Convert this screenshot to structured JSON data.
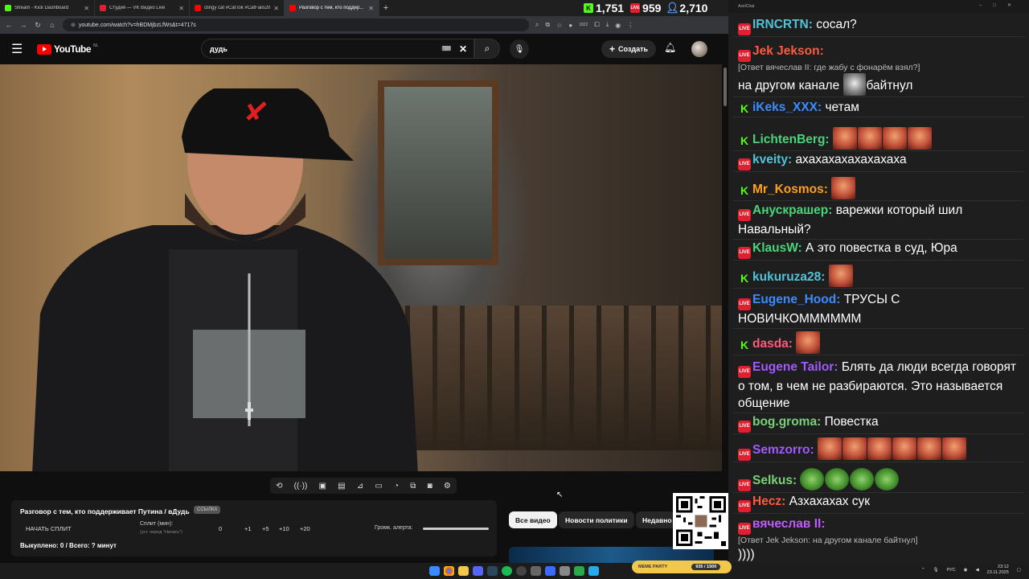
{
  "tabs": [
    {
      "title": "Stream - Kick Dashboard",
      "color": "#53fc18",
      "active": false
    },
    {
      "title": "Студия — VK Видео Live",
      "color": "#e0202f",
      "active": false
    },
    {
      "title": "clingy cat #CatTok #CatFails20...",
      "color": "#ff0000",
      "active": false
    },
    {
      "title": "Разговор с тем, кто поддер...",
      "color": "#ff0000",
      "active": true
    }
  ],
  "counters": [
    {
      "icon": "K",
      "value": "1,751",
      "color": "#53fc18"
    },
    {
      "icon": "LIVE",
      "value": "959",
      "color": "#e0202f"
    },
    {
      "icon": "person",
      "value": "2,710",
      "color": "#5aa0ff"
    }
  ],
  "browser": {
    "url": "youtube.com/watch?v=hBDMjbzLfWs&t=4717s",
    "ext_count": "1822"
  },
  "youtube": {
    "logo_text": "YouTube",
    "region": "NL",
    "search_value": "дудь",
    "create_label": "Создать"
  },
  "split_panel": {
    "title": "Разговор с тем, кто поддерживает Путина / вДудь",
    "badge": "ССЫЛКА",
    "start_label": "НАЧАТЬ СПЛИТ",
    "split_label": "Сплит (мин):",
    "split_hint": "(уст. перед \"Начать\")",
    "values": [
      "0",
      "+1",
      "+5",
      "+10",
      "+20"
    ],
    "volume_label": "Громк. алерта:",
    "bought_text": "Выкуплено: 0 / Всего: ? минут"
  },
  "chips": [
    "Все видео",
    "Новости политики",
    "Недавно"
  ],
  "chat_window": {
    "title": "AxelChat"
  },
  "chat": [
    {
      "platform": "live",
      "user": "IRNCRTN:",
      "color": "#4fc3d8",
      "text": "сосал?"
    },
    {
      "platform": "live",
      "user": "Jek Jekson:",
      "color": "#ff5a3c",
      "reply": "[Ответ вячеслав II: где жабу с фонарём взял?]",
      "text_pre": "на другом канале",
      "emote": "gray",
      "text": "байтнул"
    },
    {
      "platform": "kick",
      "user": "iKeks_XXX:",
      "color": "#3b8cff",
      "text": "четам"
    },
    {
      "platform": "kick",
      "user": "LichtenBerg:",
      "color": "#4ad37a",
      "emotes": 4
    },
    {
      "platform": "live",
      "user": "kveity:",
      "color": "#4fc3d8",
      "text": "ахахахахахахахаха"
    },
    {
      "platform": "kick",
      "user": "Mr_Kosmos:",
      "color": "#ff9f1a",
      "emotes": 1
    },
    {
      "platform": "live",
      "user": "Анускрашер:",
      "color": "#4ad37a",
      "text": "варежки который шил Навальный?"
    },
    {
      "platform": "live",
      "user": "KlausW:",
      "color": "#4ad37a",
      "text": "А это повестка в суд, Юра"
    },
    {
      "platform": "kick",
      "user": "kukuruza28:",
      "color": "#4fc3d8",
      "emotes": 1
    },
    {
      "platform": "live",
      "user": "Eugene_Hood:",
      "color": "#3b8cff",
      "text": "ТРУСЫ С НОВИЧКОММММММ"
    },
    {
      "platform": "kick",
      "user": "dasda:",
      "color": "#ff5a7a",
      "emotes": 1
    },
    {
      "platform": "live",
      "user": "Eugene Tailor:",
      "color": "#a05aff",
      "text": "Блять да люди всегда говорят о том, в чем не разбираются. Это называется общение"
    },
    {
      "platform": "live",
      "user": "bog.groma:",
      "color": "#7ad07a",
      "text": "Повестка"
    },
    {
      "platform": "live",
      "user": "Semzorro:",
      "color": "#a05aff",
      "emotes": 6
    },
    {
      "platform": "live",
      "user": "Selkus:",
      "color": "#7ad07a",
      "frogs": 4
    },
    {
      "platform": "live",
      "user": "Hecz:",
      "color": "#ff5a3c",
      "text": "Азхахахах сук"
    },
    {
      "platform": "live",
      "user": "вячеслав II:",
      "color": "#c05aff",
      "reply": "[Ответ Jek Jekson: на другом канале байтнул]",
      "text": "))))"
    }
  ],
  "meme_party": {
    "label": "MEME PARTY",
    "progress": "935 / 1500"
  },
  "tray": {
    "lang": "РУС",
    "time": "23:12",
    "date": "23.11.2025"
  }
}
